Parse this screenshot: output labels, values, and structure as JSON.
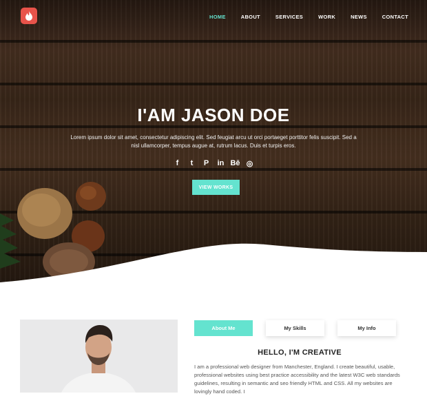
{
  "header": {
    "logo_icon": "flame-icon",
    "nav": [
      {
        "label": "HOME",
        "active": true
      },
      {
        "label": "ABOUT",
        "active": false
      },
      {
        "label": "SERVICES",
        "active": false
      },
      {
        "label": "WORK",
        "active": false
      },
      {
        "label": "NEWS",
        "active": false
      },
      {
        "label": "CONTACT",
        "active": false
      }
    ]
  },
  "hero": {
    "title": "I'AM JASON DOE",
    "text": "Lorem ipsum dolor sit amet, consectetur adipiscing elit. Sed feugiat arcu ut orci portaeget porttitor felis suscipit. Sed a nisl ullamcorper, tempus augue at, rutrum lacus. Duis et turpis eros.",
    "socials": [
      {
        "icon": "facebook-icon",
        "glyph": "f"
      },
      {
        "icon": "twitter-icon",
        "glyph": "t"
      },
      {
        "icon": "pinterest-icon",
        "glyph": "P"
      },
      {
        "icon": "linkedin-icon",
        "glyph": "in"
      },
      {
        "icon": "behance-icon",
        "glyph": "Bē"
      },
      {
        "icon": "instagram-icon",
        "glyph": "◎"
      }
    ],
    "cta_label": "VIEW WORKS"
  },
  "about": {
    "tabs": [
      {
        "label": "About Me",
        "active": true
      },
      {
        "label": "My Skills",
        "active": false
      },
      {
        "label": "My Info",
        "active": false
      }
    ],
    "title": "HELLO, I'M CREATIVE",
    "text": "I am a professional web designer from Manchester, England. I create beautiful, usable, professional websites using best practice accessibility and the latest W3C web standards guidelines, resulting in semantic and seo friendly HTML and CSS. All my websites are lovingly hand coded. I"
  },
  "colors": {
    "accent": "#64e3cf",
    "logo": "#e8534a",
    "wood_dark": "#2a1c14"
  }
}
